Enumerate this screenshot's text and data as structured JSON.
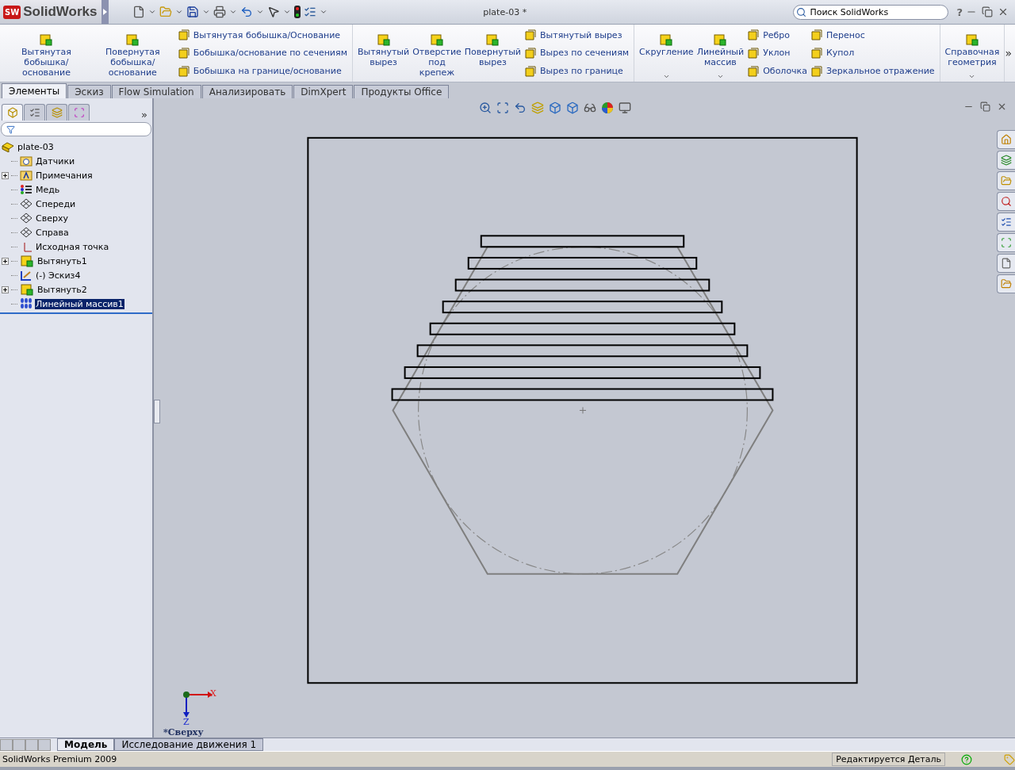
{
  "title_bar": {
    "logo_badge": "SW",
    "logo": "SolidWorks",
    "document_title": "plate-03 *",
    "search": {
      "placeholder": "Поиск SolidWorks"
    },
    "help": "?"
  },
  "ribbon": {
    "groups": [
      {
        "large": [
          {
            "label": "Вытянутая\nбобышка/основание",
            "dropdown": false
          },
          {
            "label": "Повернутая\nбобышка/основание",
            "dropdown": false
          }
        ],
        "columns": [
          [
            "Вытянутая бобышка/Основание",
            "Бобышка/основание по сечениям",
            "Бобышка на границе/основание"
          ]
        ]
      },
      {
        "large": [
          {
            "label": "Вытянутый\nвырез",
            "dropdown": false
          },
          {
            "label": "Отверстие\nпод\nкрепеж",
            "dropdown": false
          },
          {
            "label": "Повернутый\nвырез",
            "dropdown": false
          }
        ],
        "columns": [
          [
            "Вытянутый вырез",
            "Вырез по сечениям",
            "Вырез по границе"
          ]
        ]
      },
      {
        "large": [
          {
            "label": "Скругление",
            "dropdown": true
          },
          {
            "label": "Линейный\nмассив",
            "dropdown": true
          }
        ],
        "columns": [
          [
            "Ребро",
            "Уклон",
            "Оболочка"
          ],
          [
            "Перенос",
            "Купол",
            "Зеркальное отражение"
          ]
        ]
      },
      {
        "large": [
          {
            "label": "Справочная\nгеометрия",
            "dropdown": true
          }
        ]
      }
    ],
    "more": "»"
  },
  "tabs": [
    {
      "label": "Элементы",
      "selected": true
    },
    {
      "label": "Эскиз",
      "selected": false
    },
    {
      "label": "Flow Simulation",
      "selected": false
    },
    {
      "label": "Анализировать",
      "selected": false
    },
    {
      "label": "DimXpert",
      "selected": false
    },
    {
      "label": "Продукты Office",
      "selected": false
    }
  ],
  "feature_manager": {
    "panel_tabs": [
      {
        "selected": true
      },
      {
        "selected": false
      },
      {
        "selected": false
      },
      {
        "selected": false
      }
    ],
    "more": "»",
    "tree": {
      "label": "plate-03",
      "kind": "part",
      "children": [
        {
          "label": "Датчики",
          "kind": "sensor-folder",
          "collapsed": false,
          "selected": false
        },
        {
          "label": "Примечания",
          "kind": "note-folder",
          "collapsed": true,
          "selected": false
        },
        {
          "label": "Медь",
          "kind": "material",
          "collapsed": false,
          "selected": false
        },
        {
          "label": "Спереди",
          "kind": "plane",
          "collapsed": false,
          "selected": false
        },
        {
          "label": "Сверху",
          "kind": "plane",
          "collapsed": false,
          "selected": false
        },
        {
          "label": "Справа",
          "kind": "plane",
          "collapsed": false,
          "selected": false
        },
        {
          "label": "Исходная точка",
          "kind": "origin",
          "collapsed": false,
          "selected": false
        },
        {
          "label": "Вытянуть1",
          "kind": "feature",
          "collapsed": true,
          "selected": false
        },
        {
          "label": "(-) Эскиз4",
          "kind": "sketch",
          "collapsed": false,
          "selected": false
        },
        {
          "label": "Вытянуть2",
          "kind": "feature",
          "collapsed": true,
          "selected": false
        },
        {
          "label": "Линейный массив1",
          "kind": "pattern",
          "collapsed": false,
          "selected": true
        }
      ]
    }
  },
  "viewport": {
    "triad": {
      "x_label": "X",
      "z_label": "Z"
    },
    "view_name": "*Сверху"
  },
  "bottom_tabs": [
    {
      "label": "Модель",
      "selected": true
    },
    {
      "label": "Исследование движения 1",
      "selected": false
    }
  ],
  "status_bar": {
    "product": "SolidWorks Premium 2009",
    "mode": "Редактируется Деталь"
  }
}
